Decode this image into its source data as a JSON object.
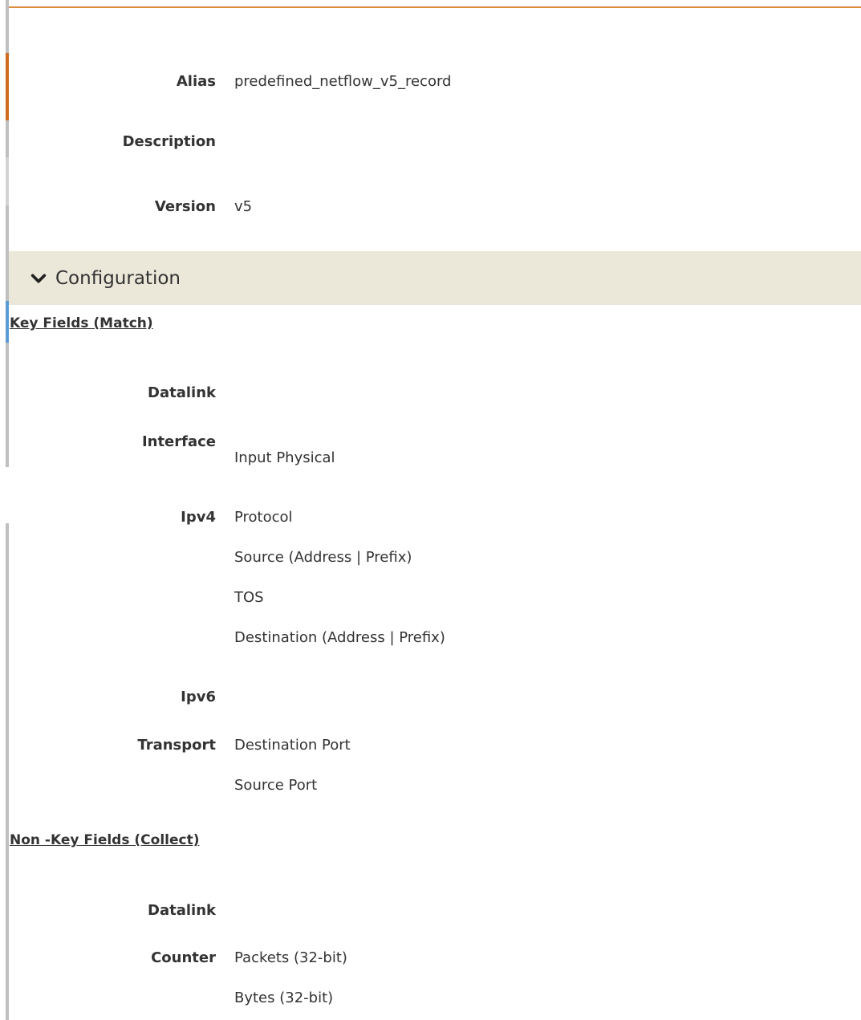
{
  "header": {
    "alias_label": "Alias",
    "alias_value": "predefined_netflow_v5_record",
    "description_label": "Description",
    "version_label": "Version",
    "version_value": "v5"
  },
  "config_section": {
    "title": "Configuration",
    "toggle_icon": "chevron-down-icon"
  },
  "key_fields": {
    "heading": "Key Fields (Match)",
    "datalink_label": "Datalink",
    "interface_label": "Interface",
    "interface_values": [
      "Input Physical"
    ],
    "ipv4_label": "Ipv4",
    "ipv4_values": [
      "Protocol",
      "Source (Address | Prefix)",
      "TOS",
      "Destination (Address | Prefix)"
    ],
    "ipv6_label": "Ipv6",
    "transport_label": "Transport",
    "transport_values": [
      "Destination Port",
      "Source Port"
    ]
  },
  "non_key_fields": {
    "heading": "Non -Key Fields (Collect)",
    "datalink_label": "Datalink",
    "counter_label": "Counter",
    "counter_values": [
      "Packets (32-bit)",
      "Bytes (32-bit)"
    ]
  },
  "colors": {
    "accent_orange": "#cf6a1e",
    "config_bar_bg": "#ebe8da",
    "edge_gray": "#bfbfbf",
    "edge_blue": "#5b9bd5",
    "text": "#333333"
  }
}
